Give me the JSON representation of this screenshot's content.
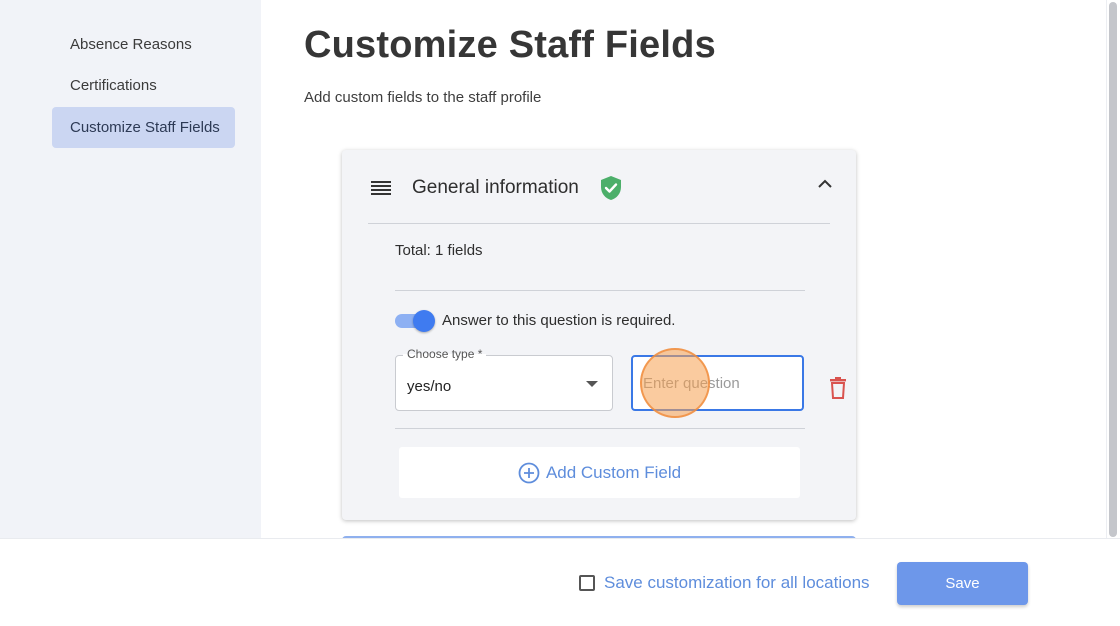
{
  "sidebar": {
    "items": [
      {
        "label": "Absence Reasons"
      },
      {
        "label": "Certifications"
      },
      {
        "label": "Customize Staff Fields"
      }
    ]
  },
  "page": {
    "title": "Customize Staff Fields",
    "subtitle": "Add custom fields to the staff profile"
  },
  "section": {
    "title": "General information",
    "total": "Total: 1 fields",
    "required_label": "Answer to this question is required.",
    "required_on": true,
    "type_label": "Choose type *",
    "type_value": "yes/no",
    "question_value": "",
    "question_placeholder": "Enter question",
    "add_field_label": "Add Custom Field"
  },
  "footer": {
    "save_all_label": "Save customization for all locations",
    "save_all_checked": false,
    "save_label": "Save"
  },
  "colors": {
    "accent": "#3a78e6",
    "link": "#5e8ddc",
    "shield": "#4caf6a",
    "delete": "#d9534f",
    "save_button": "#6d97ea",
    "active_nav": "#cbd6f2"
  },
  "icons": [
    "menu-icon",
    "shield-check-icon",
    "chevron-up-icon",
    "caret-down-icon",
    "trash-icon",
    "plus-circle-icon"
  ]
}
